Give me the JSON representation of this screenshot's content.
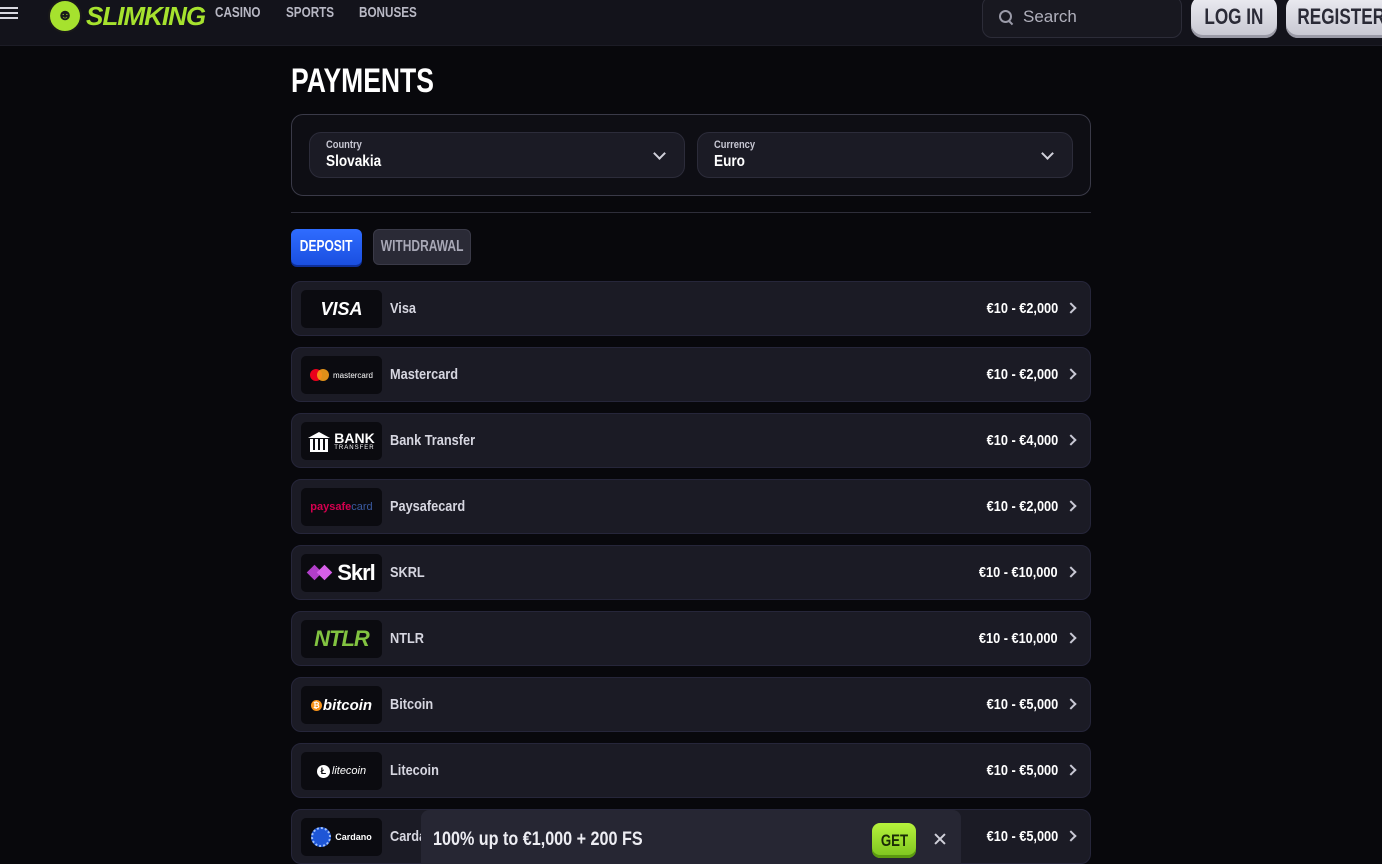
{
  "header": {
    "logo_text": "SLIMKING",
    "nav": [
      {
        "label": "CASINO"
      },
      {
        "label": "SPORTS"
      },
      {
        "label": "BONUSES"
      }
    ],
    "search_placeholder": "Search",
    "login_label": "LOG IN",
    "register_label": "REGISTER"
  },
  "page": {
    "title": "PAYMENTS",
    "country": {
      "label": "Country",
      "value": "Slovakia"
    },
    "currency": {
      "label": "Currency",
      "value": "Euro"
    },
    "tabs": {
      "deposit": "DEPOSIT",
      "withdrawal": "WITHDRAWAL"
    },
    "active_tab": "deposit"
  },
  "methods": [
    {
      "name": "Visa",
      "range": "€10 - €2,000",
      "logo_text": "VISA",
      "logo_icon": "visa-logo"
    },
    {
      "name": "Mastercard",
      "range": "€10 - €2,000",
      "logo_text": "mastercard",
      "logo_icon": "mastercard-logo"
    },
    {
      "name": "Bank Transfer",
      "range": "€10 - €4,000",
      "logo_text": "BANK",
      "logo_subtext": "TRANSFER",
      "logo_icon": "bank-logo"
    },
    {
      "name": "Paysafecard",
      "range": "€10 - €2,000",
      "logo_text": "paysafe",
      "logo_subtext": "card",
      "logo_icon": "paysafecard-logo"
    },
    {
      "name": "SKRL",
      "range": "€10 - €10,000",
      "logo_text": "Skrl",
      "logo_icon": "skrill-logo"
    },
    {
      "name": "NTLR",
      "range": "€10 - €10,000",
      "logo_text": "NTLR",
      "logo_icon": "neteller-logo"
    },
    {
      "name": "Bitcoin",
      "range": "€10 - €5,000",
      "logo_text": "bitcoin",
      "logo_icon": "bitcoin-logo"
    },
    {
      "name": "Litecoin",
      "range": "€10 - €5,000",
      "logo_text": "litecoin",
      "logo_icon": "litecoin-logo"
    },
    {
      "name": "Carda",
      "range": "€10 - €5,000",
      "logo_text": "Cardano",
      "logo_icon": "cardano-logo"
    }
  ],
  "promo": {
    "text": "100% up to €1,000 + 200 FS",
    "button_label": "GET"
  },
  "colors": {
    "accent_blue": "#2f6cff",
    "accent_green": "#a6e22e",
    "background": "#08080c",
    "row_bg": "#1b1b25"
  }
}
